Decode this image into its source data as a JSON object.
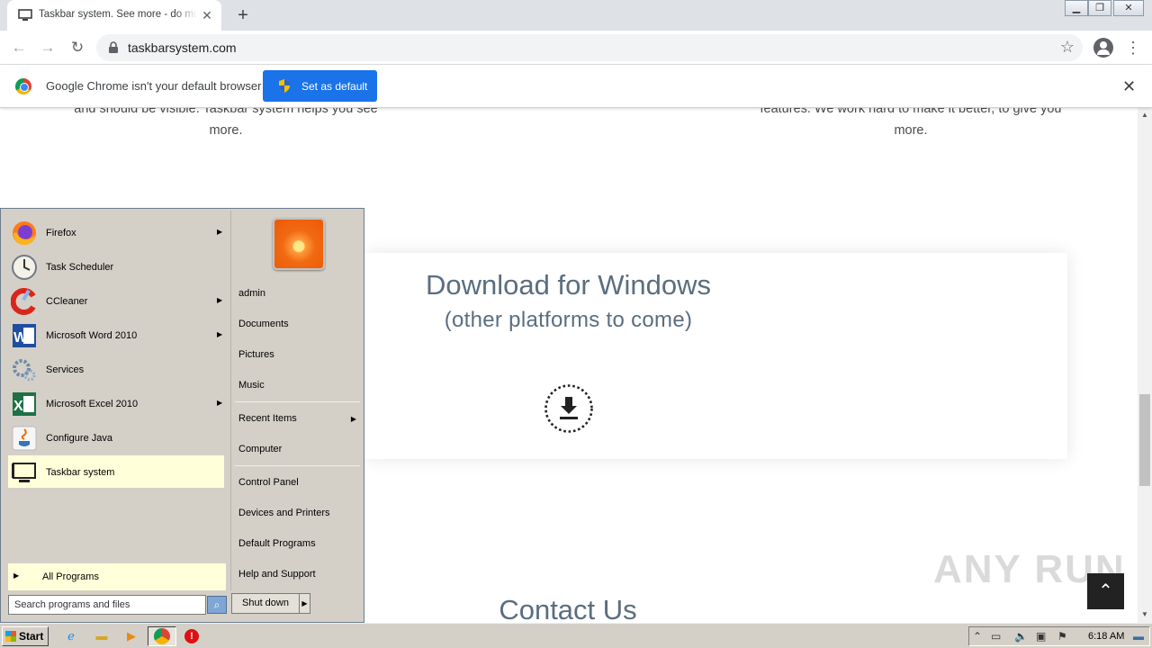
{
  "browser": {
    "tab_title": "Taskbar system. See more - do more",
    "url": "taskbarsystem.com",
    "infobar": {
      "message": "Google Chrome isn't your default browser",
      "button_label": "Set as default"
    }
  },
  "page": {
    "feature_left": "and should be visible. Taskbar system helps you see more.",
    "feature_right": "features. We work hard to make it better, to give you more.",
    "download_title": "Download for Windows",
    "download_subtitle": "(other platforms to come)",
    "contact_title": "Contact Us",
    "watermark": "ANY RUN"
  },
  "start_menu": {
    "programs": [
      {
        "label": "Firefox",
        "icon": "firefox-icon",
        "submenu": true
      },
      {
        "label": "Task Scheduler",
        "icon": "task-scheduler-icon",
        "submenu": false
      },
      {
        "label": "CCleaner",
        "icon": "ccleaner-icon",
        "submenu": true
      },
      {
        "label": "Microsoft Word 2010",
        "icon": "word-icon",
        "submenu": true
      },
      {
        "label": "Services",
        "icon": "services-icon",
        "submenu": false
      },
      {
        "label": "Microsoft Excel 2010",
        "icon": "excel-icon",
        "submenu": true
      },
      {
        "label": "Configure Java",
        "icon": "java-icon",
        "submenu": false
      },
      {
        "label": "Taskbar system",
        "icon": "taskbar-system-icon",
        "submenu": false
      }
    ],
    "all_programs": "All Programs",
    "search_placeholder": "Search programs and files",
    "places": {
      "user": "admin",
      "documents": "Documents",
      "pictures": "Pictures",
      "music": "Music",
      "recent": "Recent Items",
      "computer": "Computer",
      "control_panel": "Control Panel",
      "devices": "Devices and Printers",
      "defaults": "Default Programs",
      "help": "Help and Support"
    },
    "shutdown": "Shut down"
  },
  "taskbar": {
    "start": "Start",
    "clock": "6:18 AM"
  },
  "colors": {
    "accent_blue": "#1a73e8",
    "heading_slate": "#5a6e80",
    "start_menu_highlight": "#ffffd9"
  }
}
